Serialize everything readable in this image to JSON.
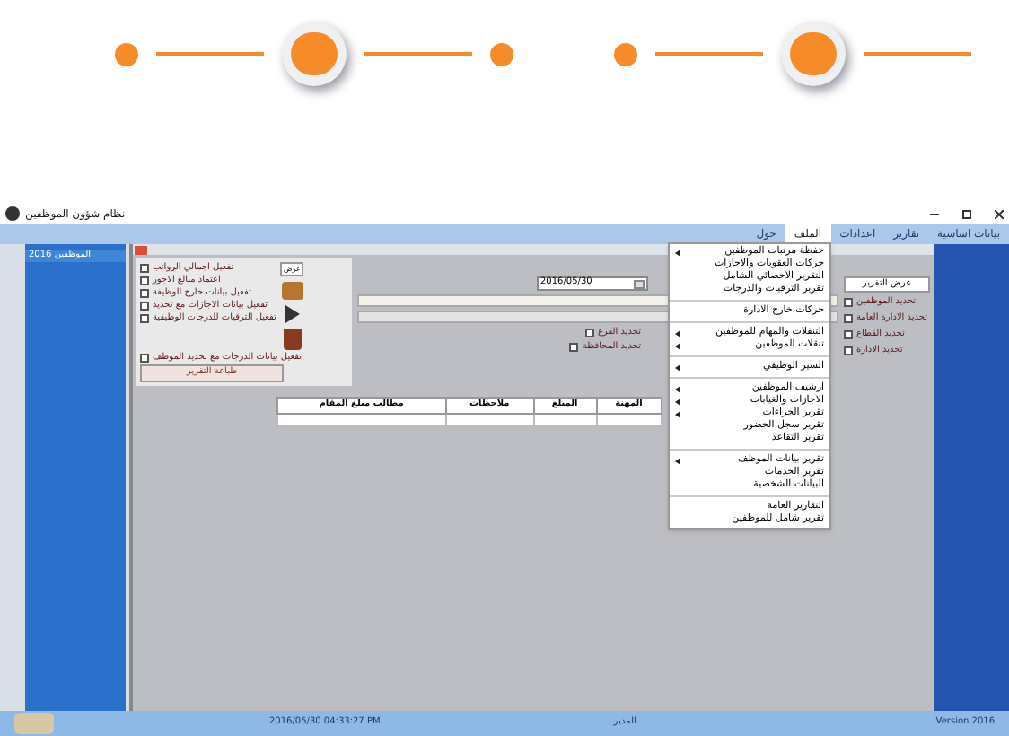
{
  "stepper": {
    "steps": [
      {
        "selected": false
      },
      {
        "selected": true
      },
      {
        "selected": false
      },
      {
        "selected": false
      },
      {
        "selected": true
      }
    ]
  },
  "window": {
    "title": "نظام شؤون الموظفين"
  },
  "menu_bar": [
    {
      "label": "بيانات اساسية",
      "selected": false
    },
    {
      "label": "تقارير",
      "selected": false
    },
    {
      "label": "اعدادات",
      "selected": false
    },
    {
      "label": "الملف",
      "selected": true
    },
    {
      "label": "حول",
      "selected": false
    }
  ],
  "menu": {
    "items": [
      {
        "kind": "item",
        "label": "حفظة مرتبات الموظفين",
        "submenu": true
      },
      {
        "kind": "item",
        "label": "حركات العقوبات والاجازات",
        "submenu": false
      },
      {
        "kind": "item",
        "label": "التقرير الاحصائي الشامل",
        "submenu": false
      },
      {
        "kind": "item",
        "label": "تقرير الترقيات والدرجات",
        "submenu": false
      },
      {
        "kind": "separator"
      },
      {
        "kind": "item",
        "label": "حركات خارج الادارة",
        "submenu": false
      },
      {
        "kind": "separator"
      },
      {
        "kind": "item",
        "label": "التنقلات والمهام للموظفين",
        "submenu": true
      },
      {
        "kind": "item",
        "label": "تنقلات الموظفين",
        "submenu": true
      },
      {
        "kind": "separator"
      },
      {
        "kind": "item",
        "label": "السير الوظيفي",
        "submenu": true
      },
      {
        "kind": "separator"
      },
      {
        "kind": "item",
        "label": "ارشيف الموظفين",
        "submenu": true
      },
      {
        "kind": "item",
        "label": "الاجازات والغيابات",
        "submenu": true
      },
      {
        "kind": "item",
        "label": "تقرير الجزاءات",
        "submenu": true
      },
      {
        "kind": "item",
        "label": "تقرير سجل الحضور",
        "submenu": false
      },
      {
        "kind": "item",
        "label": "تقرير التقاعد",
        "submenu": false
      },
      {
        "kind": "separator"
      },
      {
        "kind": "item",
        "label": "تقرير بيانات الموظف",
        "submenu": true
      },
      {
        "kind": "item",
        "label": "تقرير الخدمات",
        "submenu": false
      },
      {
        "kind": "item",
        "label": "البيانات الشخصية",
        "submenu": false
      },
      {
        "kind": "separator"
      },
      {
        "kind": "item",
        "label": "التقارير العامة",
        "submenu": false
      },
      {
        "kind": "item",
        "label": "تقرير شامل للموظفين",
        "submenu": false
      }
    ]
  },
  "sidebar": {
    "header": "الموظفين 2016"
  },
  "dialog": {
    "options": [
      {
        "label": "تفعيل اجمالي الرواتب",
        "checked": false
      },
      {
        "label": "اعتماد مبالغ الاجور",
        "checked": false
      },
      {
        "label": "تفعيل بيانات خارج الوظيفة",
        "checked": false
      },
      {
        "label": "تفعيل بيانات الاجازات مع تحديد",
        "checked": false
      },
      {
        "label": "تفعيل الترقيات للدرجات الوظيفية",
        "checked": false
      }
    ],
    "extra_option": {
      "label": "تفعيل بيانات الدرجات مع تحديد الموظف",
      "checked": false
    },
    "print_button": "طباعة التقرير",
    "view_button": "عرض",
    "date": "2016/05/30",
    "filters": [
      {
        "label": "تحديد الفرع",
        "checked": false
      },
      {
        "label": "تحديد المحافظة",
        "checked": false
      }
    ],
    "right_filters": [
      {
        "label": "تحديد الموظفين",
        "checked": false
      },
      {
        "label": "تحديد الادارة العامة",
        "checked": false
      },
      {
        "label": "تحديد القطاع",
        "checked": false
      },
      {
        "label": "تحديد الادارة",
        "checked": false
      }
    ],
    "show_button": "عرض التقرير",
    "table": {
      "columns": [
        "المهنة",
        "المبلغ",
        "ملاحظات",
        "مطالب مبلغ المقام"
      ]
    }
  },
  "status_bar": {
    "datetime": "2016/05/30   04:33:27 PM",
    "user": "المدير",
    "version": "Version 2016"
  }
}
